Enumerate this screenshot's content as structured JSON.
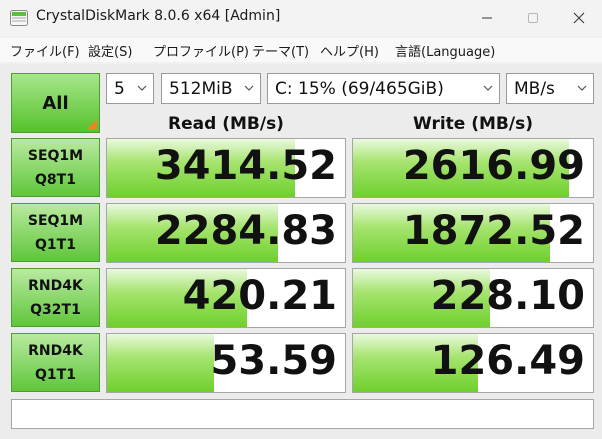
{
  "window": {
    "title": "CrystalDiskMark 8.0.6 x64 [Admin]",
    "app_icon": "crystaldiskmark-icon",
    "controls": [
      "minimize-icon",
      "maximize-icon",
      "close-icon"
    ]
  },
  "menu": [
    "ファイル(F)",
    "設定(S)",
    "プロファイル(P)",
    "テーマ(T)",
    "ヘルプ(H)",
    "言語(Language)"
  ],
  "controls": {
    "all_button": "All",
    "count": "5",
    "size": "512MiB",
    "drive": "C: 15% (69/465GiB)",
    "unit": "MB/s"
  },
  "headers": {
    "read": "Read (MB/s)",
    "write": "Write (MB/s)"
  },
  "tests": [
    {
      "line1": "SEQ1M",
      "line2": "Q8T1",
      "read": "3414.52",
      "write": "2616.99",
      "read_fill": 0.79,
      "write_fill": 0.9
    },
    {
      "line1": "SEQ1M",
      "line2": "Q1T1",
      "read": "2284.83",
      "write": "1872.52",
      "read_fill": 0.72,
      "write_fill": 0.82
    },
    {
      "line1": "RND4K",
      "line2": "Q32T1",
      "read": "420.21",
      "write": "228.10",
      "read_fill": 0.59,
      "write_fill": 0.57
    },
    {
      "line1": "RND4K",
      "line2": "Q1T1",
      "read": "53.59",
      "write": "126.49",
      "read_fill": 0.45,
      "write_fill": 0.52
    }
  ],
  "colors": {
    "bar_green": "#6ed02c",
    "button_green": "#55c22c",
    "all_corner": "#e8862a"
  }
}
